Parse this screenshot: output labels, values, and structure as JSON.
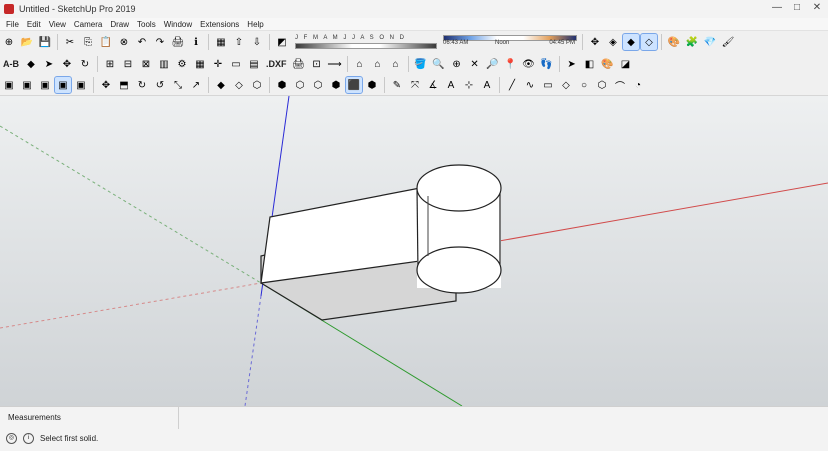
{
  "window": {
    "title": "Untitled - SketchUp Pro 2019",
    "controls": [
      "—",
      "□",
      "✕"
    ]
  },
  "menu": {
    "items": [
      "File",
      "Edit",
      "View",
      "Camera",
      "Draw",
      "Tools",
      "Window",
      "Extensions",
      "Help"
    ]
  },
  "toolbar_top": {
    "shadow_months": "J F M A M J J A S O N D",
    "time_start": "06:43 AM",
    "time_noon": "Noon",
    "time_end": "04:45 PM"
  },
  "toolbar_mid": {
    "ab_text": "A-B",
    "dxf_text": ".DXF"
  },
  "status": {
    "measurements_label": "Measurements",
    "message": "Select first solid."
  }
}
